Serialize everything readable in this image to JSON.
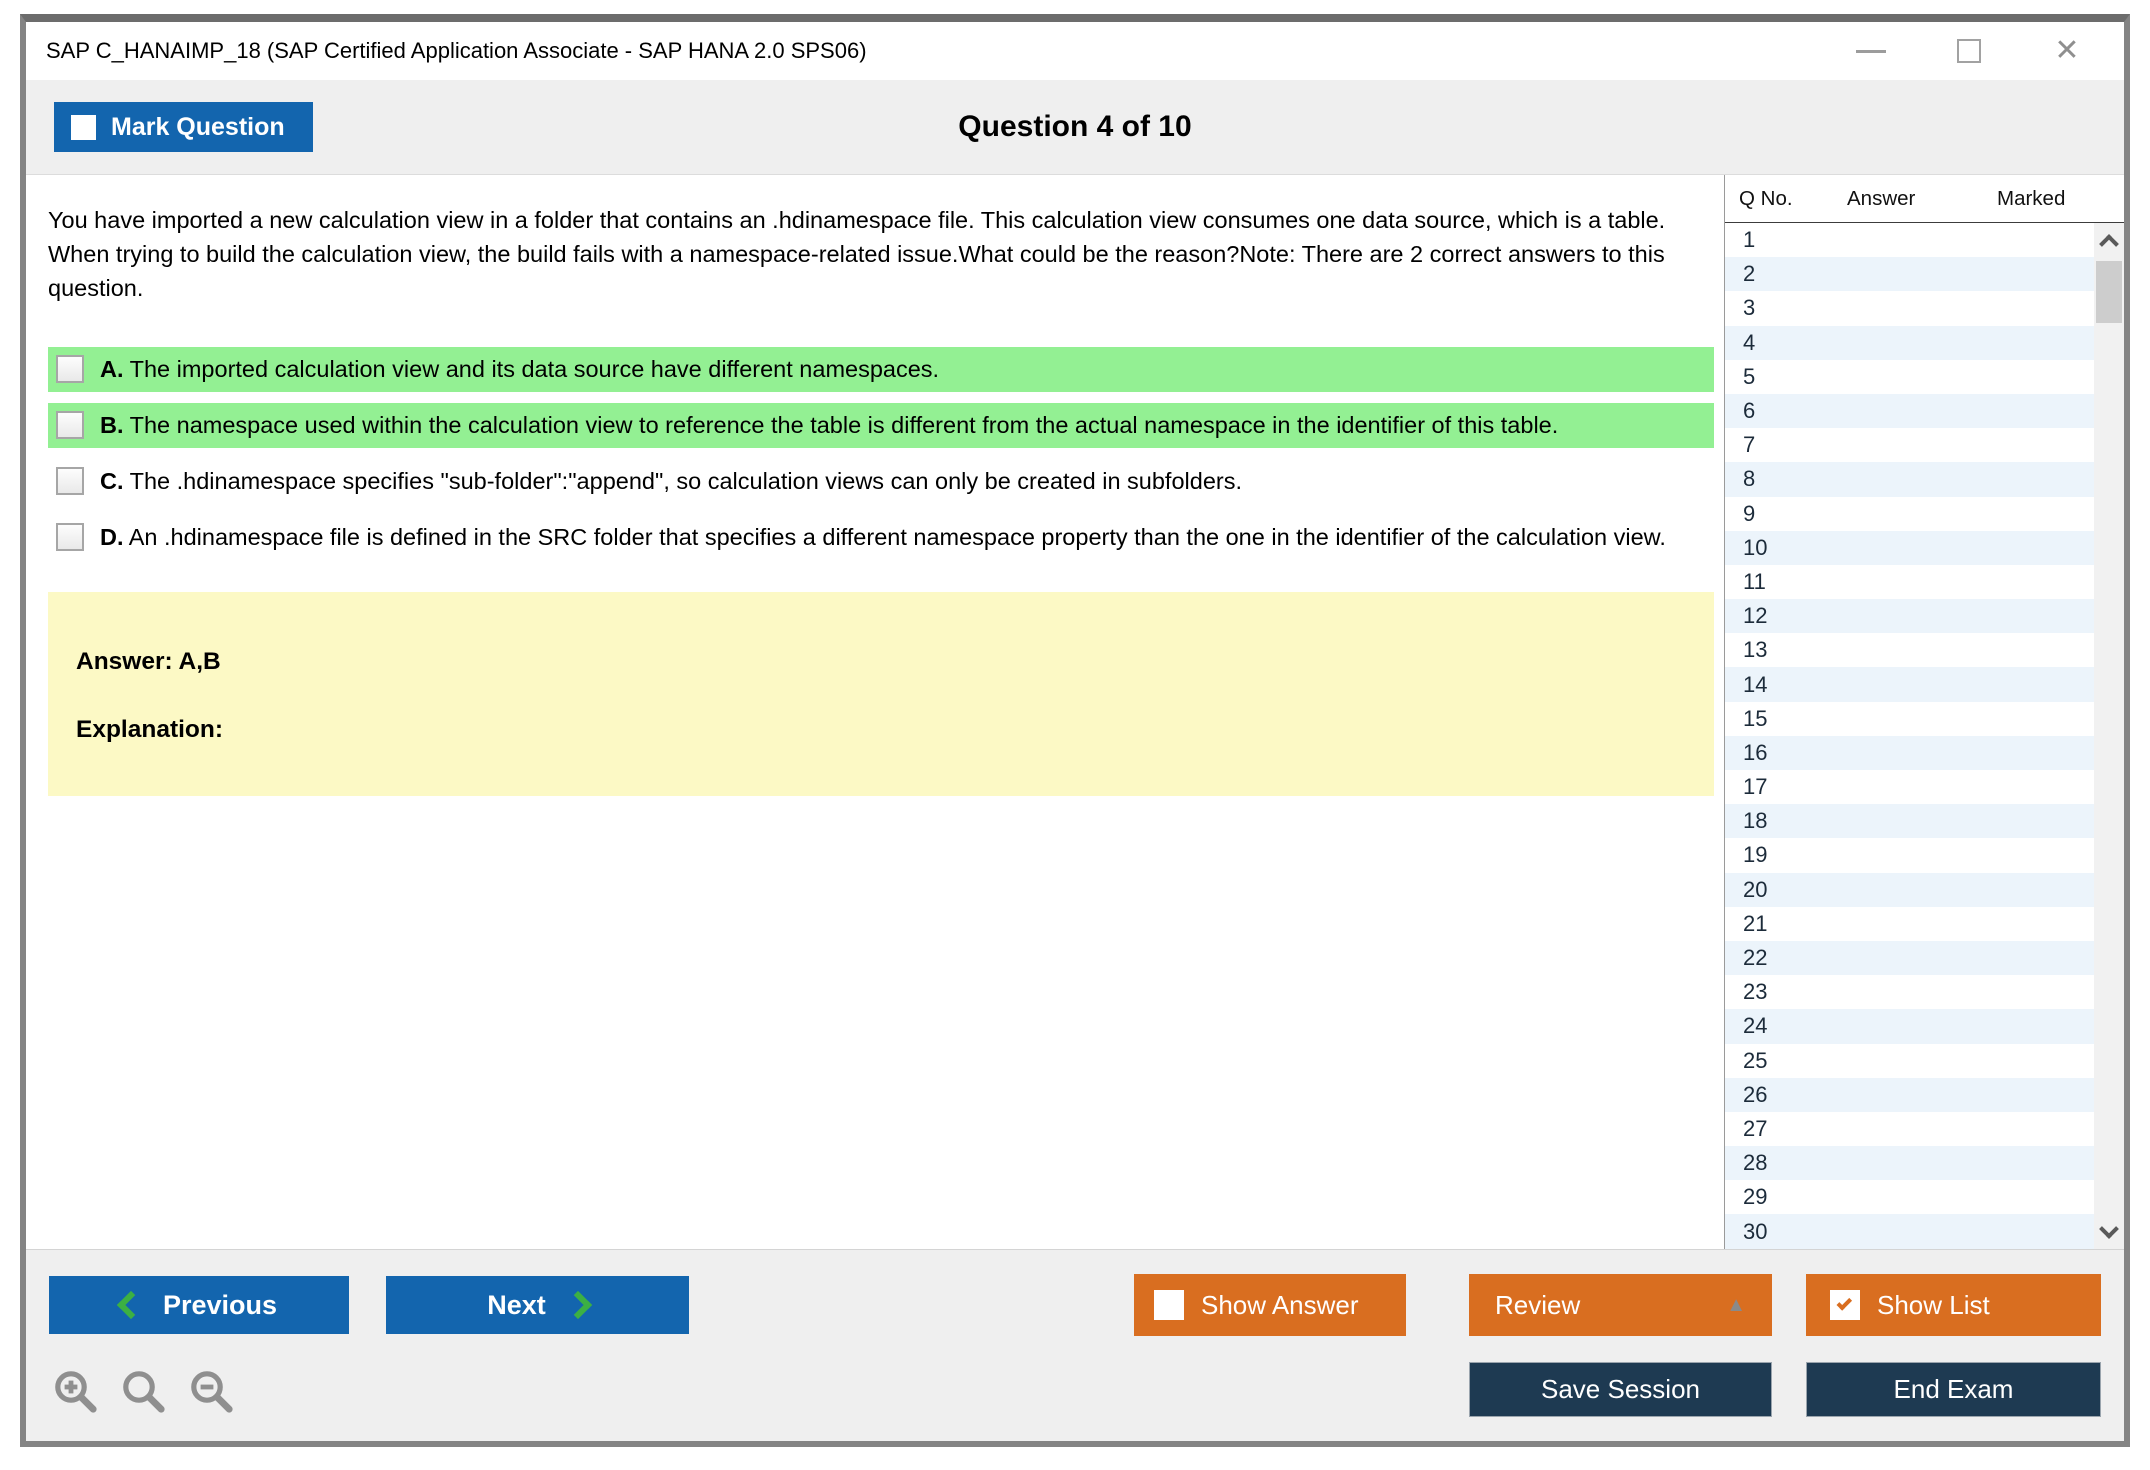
{
  "window": {
    "title": "SAP C_HANAIMP_18 (SAP Certified Application Associate - SAP HANA 2.0 SPS06)"
  },
  "icons": {
    "close": "✕",
    "review_caret": "▲"
  },
  "header": {
    "mark_question": "Mark Question",
    "question_counter": "Question 4 of 10"
  },
  "question": {
    "text": "You have imported a new calculation view in a folder that contains an .hdinamespace file. This calculation view consumes one data source, which is a table. When trying to build the calculation view, the build fails with a namespace-related issue.What could be the reason?Note: There are 2 correct answers to this question.",
    "options": [
      {
        "letter": "A.",
        "text": "The imported calculation view and its data source have different namespaces.",
        "highlighted": true
      },
      {
        "letter": "B.",
        "text": "The namespace used within the calculation view to reference the table is different from the actual namespace in the identifier of this table.",
        "highlighted": true
      },
      {
        "letter": "C.",
        "text": "The .hdinamespace specifies \"sub-folder\":\"append\", so calculation views can only be created in subfolders.",
        "highlighted": false
      },
      {
        "letter": "D.",
        "text": "An .hdinamespace file is defined in the SRC folder that specifies a different namespace property than the one in the identifier of the calculation view.",
        "highlighted": false
      }
    ]
  },
  "answer_panel": {
    "answer": "Answer: A,B",
    "explanation": "Explanation:"
  },
  "sidebar": {
    "columns": {
      "qno": "Q No.",
      "answer": "Answer",
      "marked": "Marked"
    },
    "rows": [
      1,
      2,
      3,
      4,
      5,
      6,
      7,
      8,
      9,
      10,
      11,
      12,
      13,
      14,
      15,
      16,
      17,
      18,
      19,
      20,
      21,
      22,
      23,
      24,
      25,
      26,
      27,
      28,
      29,
      30
    ]
  },
  "footer": {
    "previous": "Previous",
    "next": "Next",
    "show_answer": "Show Answer",
    "review": "Review",
    "show_list": "Show List",
    "save_session": "Save Session",
    "end_exam": "End Exam"
  },
  "colors": {
    "accent_blue": "#1365ae",
    "accent_orange": "#d96e20",
    "navy": "#1e3a52",
    "highlight_green": "#93f093",
    "answer_yellow": "#fcf9c5",
    "chevron_green": "#3cb043",
    "band_gray": "#efefef",
    "alt_row_blue": "#ecf4fb"
  }
}
